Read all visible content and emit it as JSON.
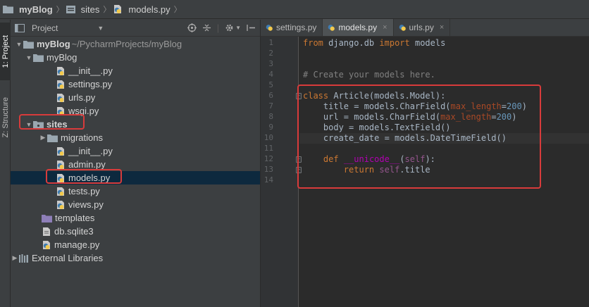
{
  "breadcrumb": [
    {
      "label": "myBlog",
      "icon": "folder-icon"
    },
    {
      "label": "sites",
      "icon": "folder-icon"
    },
    {
      "label": "models.py",
      "icon": "python-file-icon"
    }
  ],
  "tool_strip": {
    "project_tab": "1: Project",
    "structure_tab": "Z: Structure"
  },
  "project_panel": {
    "title": "Project",
    "tree": [
      {
        "label": "myBlog",
        "path": "~/PycharmProjects/myBlog",
        "depth": 0,
        "type": "folder",
        "expanded": true,
        "bold": true
      },
      {
        "label": "myBlog",
        "depth": 1,
        "type": "folder",
        "expanded": true
      },
      {
        "label": "__init__.py",
        "depth": 2,
        "type": "py"
      },
      {
        "label": "settings.py",
        "depth": 2,
        "type": "py"
      },
      {
        "label": "urls.py",
        "depth": 2,
        "type": "py"
      },
      {
        "label": "wsgi.py",
        "depth": 2,
        "type": "py"
      },
      {
        "label": "sites",
        "depth": 1,
        "type": "folder",
        "expanded": true
      },
      {
        "label": "migrations",
        "depth": 2,
        "type": "folder",
        "expanded": false
      },
      {
        "label": "__init__.py",
        "depth": 2,
        "type": "py"
      },
      {
        "label": "admin.py",
        "depth": 2,
        "type": "py"
      },
      {
        "label": "models.py",
        "depth": 2,
        "type": "py",
        "selected": true
      },
      {
        "label": "tests.py",
        "depth": 2,
        "type": "py"
      },
      {
        "label": "views.py",
        "depth": 2,
        "type": "py"
      },
      {
        "label": "templates",
        "depth": 1,
        "type": "folder-purple"
      },
      {
        "label": "db.sqlite3",
        "depth": 1,
        "type": "db"
      },
      {
        "label": "manage.py",
        "depth": 1,
        "type": "py"
      },
      {
        "label": "External Libraries",
        "depth": 0,
        "type": "library",
        "expanded": false
      }
    ]
  },
  "editor": {
    "tabs": [
      {
        "label": "settings.py",
        "active": false
      },
      {
        "label": "models.py",
        "active": true
      },
      {
        "label": "urls.py",
        "active": false
      }
    ],
    "line_numbers": [
      "1",
      "2",
      "3",
      "4",
      "5",
      "6",
      "7",
      "8",
      "9",
      "10",
      "11",
      "12",
      "13",
      "14"
    ]
  },
  "colors": {
    "keyword": "#cc7832",
    "comment": "#808080",
    "number": "#6897bb",
    "param": "#aa4926",
    "highlight_box": "#d83b3b",
    "selection": "#0d293e"
  }
}
